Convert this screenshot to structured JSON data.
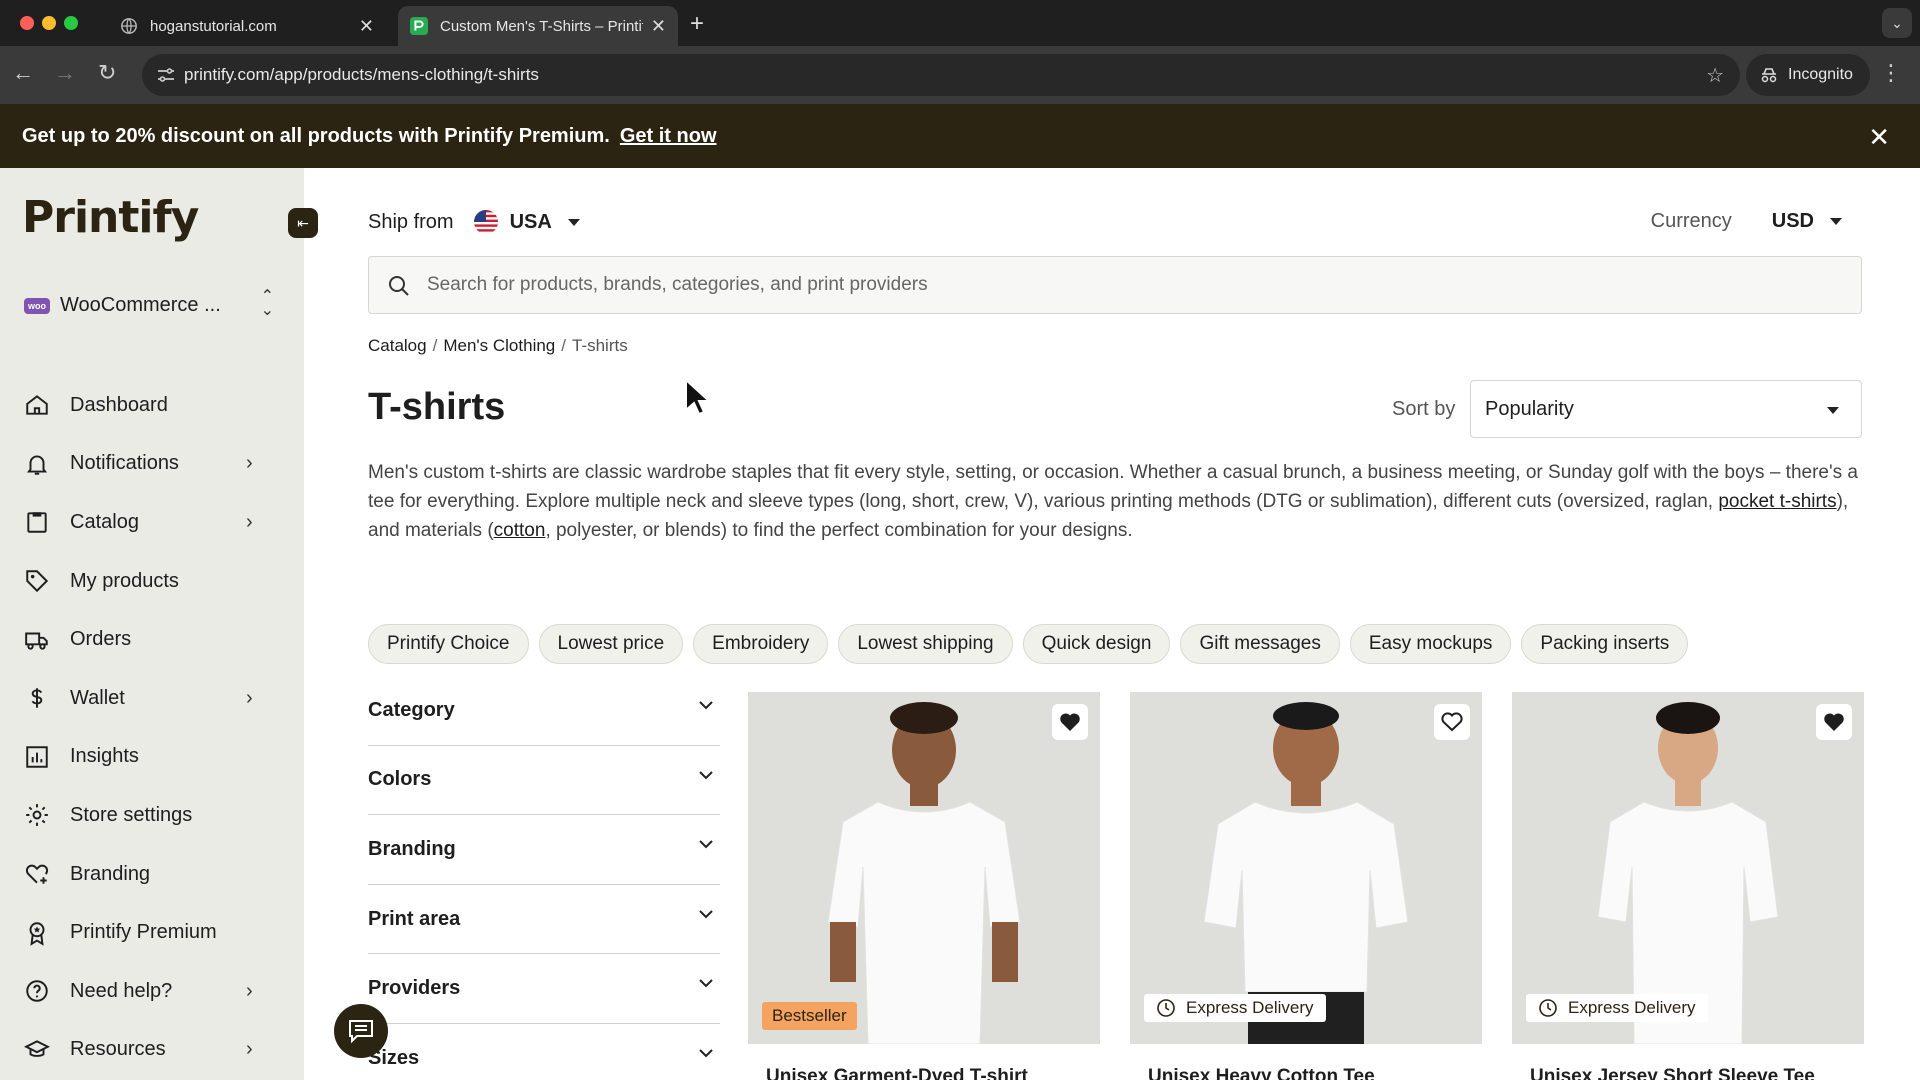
{
  "browser": {
    "tabs": [
      {
        "title": "hoganstutorial.com",
        "active": false
      },
      {
        "title": "Custom Men's T-Shirts – Printify",
        "active": true
      }
    ],
    "url": "printify.com/app/products/mens-clothing/t-shirts",
    "incognito_label": "Incognito"
  },
  "promo": {
    "text": "Get up to 20% discount on all products with Printify Premium.",
    "link": "Get it now"
  },
  "sidebar": {
    "logo": "Printify",
    "store": "WooCommerce ...",
    "items": [
      {
        "label": "Dashboard",
        "icon": "home-icon",
        "has_chevron": false
      },
      {
        "label": "Notifications",
        "icon": "bell-icon",
        "has_chevron": true
      },
      {
        "label": "Catalog",
        "icon": "clipboard-icon",
        "has_chevron": true
      },
      {
        "label": "My products",
        "icon": "tag-icon",
        "has_chevron": false
      },
      {
        "label": "Orders",
        "icon": "truck-icon",
        "has_chevron": false
      },
      {
        "label": "Wallet",
        "icon": "dollar-icon",
        "has_chevron": true
      },
      {
        "label": "Insights",
        "icon": "chart-icon",
        "has_chevron": false
      },
      {
        "label": "Store settings",
        "icon": "gear-icon",
        "has_chevron": false
      },
      {
        "label": "Branding",
        "icon": "heart-plus-icon",
        "has_chevron": false
      },
      {
        "label": "Printify Premium",
        "icon": "award-icon",
        "has_chevron": false
      },
      {
        "label": "Need help?",
        "icon": "help-icon",
        "has_chevron": true
      },
      {
        "label": "Resources",
        "icon": "graduation-cap-icon",
        "has_chevron": true
      }
    ]
  },
  "header": {
    "ship_from_label": "Ship from",
    "ship_from_value": "USA",
    "currency_label": "Currency",
    "currency_value": "USD"
  },
  "search": {
    "placeholder": "Search for products, brands, categories, and print providers"
  },
  "breadcrumb": [
    "Catalog",
    "Men's Clothing",
    "T-shirts"
  ],
  "page": {
    "title": "T-shirts",
    "sort_label": "Sort by",
    "sort_value": "Popularity",
    "description": {
      "p1": "Men's custom t-shirts are classic wardrobe staples that fit every style, setting, or occasion. Whether a casual brunch, a business meeting, or Sunday golf with the boys – there's a tee for everything. Explore multiple neck and sleeve types (long, short, crew, V), various printing methods (DTG or sublimation), different cuts (oversized, raglan, ",
      "link1": "pocket t-shirts",
      "p2": "), and materials (",
      "link2": "cotton",
      "p3": ", polyester, or blends) to find the perfect combination for your designs."
    }
  },
  "chips": [
    "Printify Choice",
    "Lowest price",
    "Embroidery",
    "Lowest shipping",
    "Quick design",
    "Gift messages",
    "Easy mockups",
    "Packing inserts"
  ],
  "filters": [
    "Category",
    "Colors",
    "Branding",
    "Print area",
    "Providers",
    "Sizes"
  ],
  "products": [
    {
      "title": "Unisex Garment-Dyed T-shirt",
      "badge": "Bestseller",
      "favorited": true,
      "skin": "#8a5a3c"
    },
    {
      "title": "Unisex Heavy Cotton Tee",
      "badge": "Express Delivery",
      "favorited": false,
      "skin": "#a06a48"
    },
    {
      "title": "Unisex Jersey Short Sleeve Tee",
      "badge": "Express Delivery",
      "favorited": true,
      "skin": "#d8a884"
    }
  ],
  "colors": {
    "brand_dark": "#2c2413",
    "sidebar_bg": "#ebebe6",
    "bestseller": "#f4a360"
  }
}
